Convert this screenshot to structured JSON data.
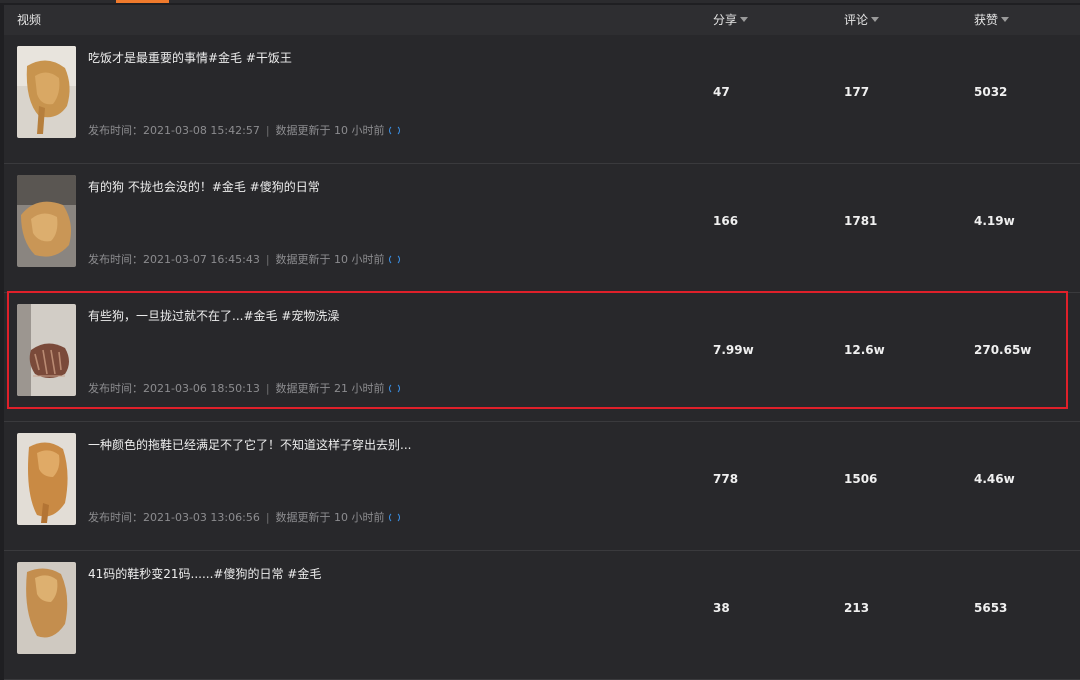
{
  "header": {
    "video_label": "视频",
    "share_label": "分享",
    "comment_label": "评论",
    "likes_label": "获赞"
  },
  "rows": [
    {
      "title": "吃饭才是最重要的事情#金毛 #干饭王",
      "publish_label": "发布时间：",
      "publish_time": "2021-03-08 15:42:57",
      "update_text": "数据更新于 10 小时前",
      "share": "47",
      "comment": "177",
      "likes": "5032",
      "thumb_icon": "golden-retriever-photo"
    },
    {
      "title": "有的狗 不拢也会没的！#金毛 #傻狗的日常",
      "publish_label": "发布时间：",
      "publish_time": "2021-03-07 16:45:43",
      "update_text": "数据更新于 10 小时前",
      "share": "166",
      "comment": "1781",
      "likes": "4.19w",
      "thumb_icon": "golden-retriever-photo"
    },
    {
      "title": "有些狗，一旦拢过就不在了...#金毛 #宠物洗澡",
      "publish_label": "发布时间：",
      "publish_time": "2021-03-06 18:50:13",
      "update_text": "数据更新于 21 小时前",
      "share": "7.99w",
      "comment": "12.6w",
      "likes": "270.65w",
      "thumb_icon": "wet-dog-photo"
    },
    {
      "title": "一种颜色的拖鞋已经满足不了它了！不知道这样子穿出去别...",
      "publish_label": "发布时间：",
      "publish_time": "2021-03-03 13:06:56",
      "update_text": "数据更新于 10 小时前",
      "share": "778",
      "comment": "1506",
      "likes": "4.46w",
      "thumb_icon": "golden-retriever-photo"
    },
    {
      "title": "41码的鞋秒变21码......#傻狗的日常 #金毛",
      "publish_label": "",
      "publish_time": "",
      "update_text": "",
      "share": "38",
      "comment": "213",
      "likes": "5653",
      "thumb_icon": "golden-retriever-photo"
    }
  ],
  "colors": {
    "accent": "#f07a2c",
    "highlight_border": "#e0202a",
    "refresh_icon": "#3a8de0"
  }
}
